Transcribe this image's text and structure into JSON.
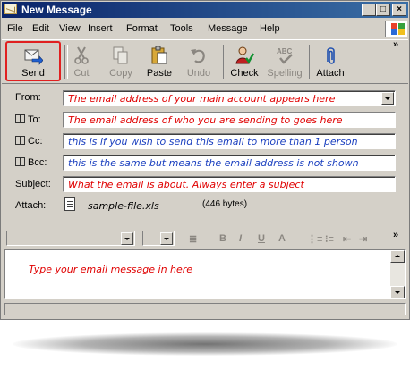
{
  "window": {
    "title": "New Message"
  },
  "menu": [
    "File",
    "Edit",
    "View",
    "Insert",
    "Format",
    "Tools",
    "Message",
    "Help"
  ],
  "toolbar": {
    "send": "Send",
    "cut": "Cut",
    "copy": "Copy",
    "paste": "Paste",
    "undo": "Undo",
    "check": "Check",
    "spelling": "Spelling",
    "attach": "Attach"
  },
  "header": {
    "from_label": "From:",
    "from_value": "The email address of your main account appears here",
    "to_label": "To:",
    "to_value": "The email address of who you are sending to goes here",
    "cc_label": "Cc:",
    "cc_value": "this is if you wish to send this email to more than 1 person",
    "bcc_label": "Bcc:",
    "bcc_value": "this is the same but means the email address is not shown",
    "subject_label": "Subject:",
    "subject_value": "What the email is about. Always enter a subject",
    "attach_label": "Attach:",
    "attachment_name": "sample-file.xls",
    "attachment_size": "(446 bytes)"
  },
  "editor": {
    "body_text": "Type your email message in here",
    "format_icons": [
      "paragraph-style",
      "bold",
      "italic",
      "underline",
      "font-color",
      "numbered-list",
      "bulleted-list",
      "decrease-indent",
      "increase-indent"
    ]
  },
  "colors": {
    "title_start": "#0a246a",
    "title_end": "#3a6ea5",
    "annotation_red": "#e00000",
    "annotation_blue": "#1a3fbf",
    "highlight_border": "#e02020",
    "chrome": "#d4d0c8"
  }
}
